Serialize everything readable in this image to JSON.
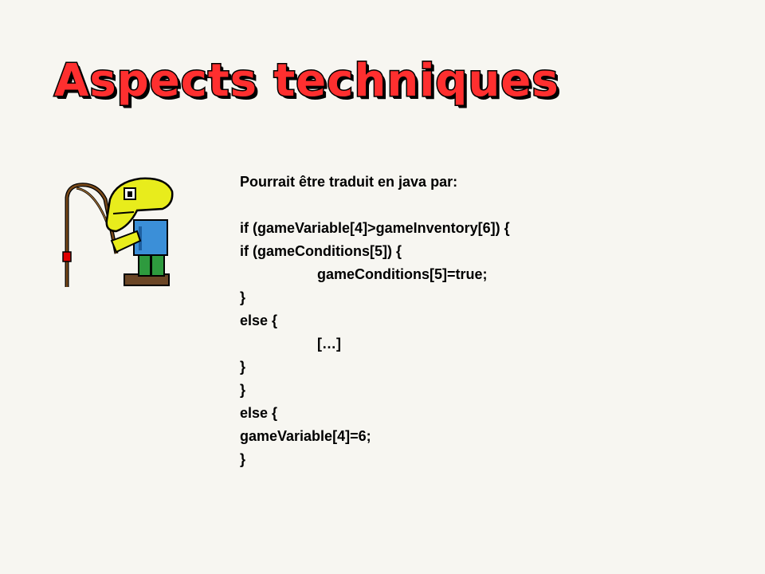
{
  "slide": {
    "title": "Aspects techniques",
    "mascot_icon": "fisherman-mascot-icon",
    "intro": "Pourrait être traduit en java par:",
    "code_lines": [
      "if (gameVariable[4]>gameInventory[6]) {",
      "if (gameConditions[5]) {",
      "gameConditions[5]=true;",
      "}",
      "else {",
      "[…]",
      "}",
      "}",
      "else {",
      "gameVariable[4]=6;",
      "}"
    ]
  },
  "colors": {
    "title_fill": "#ff2f2f",
    "title_outline": "#000000",
    "text": "#000000",
    "mascot_yellow": "#e8ec1c",
    "mascot_blue": "#3b8fd8",
    "mascot_green": "#2e9a3e"
  }
}
